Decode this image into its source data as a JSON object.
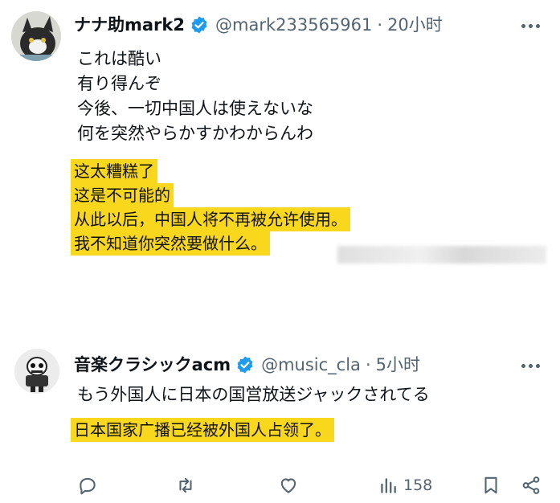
{
  "tweets": [
    {
      "display_name": "ナナ助mark2",
      "handle": "@mark233565961",
      "separator": "·",
      "time": "20小时",
      "verified_icon": "verified-badge-icon",
      "lines": [
        "これは酷い",
        "有り得んぞ",
        "今後、一切中国人は使えないな",
        "何を突然やらかすかわからんわ"
      ],
      "translation": [
        "这太糟糕了",
        "这是不可能的",
        "从此以后，中国人将不再被允许使用。",
        "我不知道你突然要做什么。"
      ]
    },
    {
      "display_name": "音楽クラシックacm",
      "handle": "@music_cla",
      "separator": "·",
      "time": "5小时",
      "verified_icon": "verified-badge-icon",
      "lines": [
        "もう外国人に日本の国営放送ジャックされてる"
      ],
      "translation": [
        "日本国家广播已经被外国人占领了。"
      ]
    }
  ],
  "actions": {
    "reply": {
      "icon": "reply-icon"
    },
    "retweet": {
      "icon": "retweet-icon"
    },
    "like": {
      "icon": "heart-icon"
    },
    "views": {
      "icon": "views-icon",
      "count": "158"
    },
    "bookmark": {
      "icon": "bookmark-icon"
    },
    "share": {
      "icon": "share-icon"
    }
  },
  "colors": {
    "highlight": "#f9d71c",
    "verified": "#1d9bf0",
    "muted": "#536471"
  }
}
